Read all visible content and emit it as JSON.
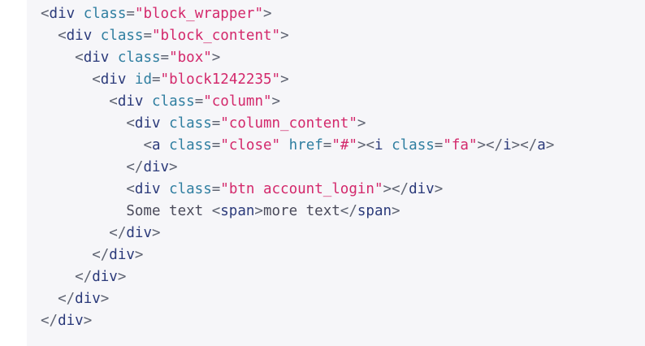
{
  "colors": {
    "background": "#f6f6f9",
    "punctuation": "#5f6472",
    "tag": "#2b3a7a",
    "attribute": "#2f7ea0",
    "value": "#d3286b",
    "text": "#4a4a5a"
  },
  "code_lines": [
    {
      "indent": 0,
      "tokens": [
        {
          "t": "punct",
          "v": "<"
        },
        {
          "t": "tag",
          "v": "div"
        },
        {
          "t": "text",
          "v": " "
        },
        {
          "t": "attr",
          "v": "class"
        },
        {
          "t": "punct",
          "v": "="
        },
        {
          "t": "value",
          "v": "\"block_wrapper\""
        },
        {
          "t": "punct",
          "v": ">"
        }
      ]
    },
    {
      "indent": 1,
      "tokens": [
        {
          "t": "punct",
          "v": "<"
        },
        {
          "t": "tag",
          "v": "div"
        },
        {
          "t": "text",
          "v": " "
        },
        {
          "t": "attr",
          "v": "class"
        },
        {
          "t": "punct",
          "v": "="
        },
        {
          "t": "value",
          "v": "\"block_content\""
        },
        {
          "t": "punct",
          "v": ">"
        }
      ]
    },
    {
      "indent": 2,
      "tokens": [
        {
          "t": "punct",
          "v": "<"
        },
        {
          "t": "tag",
          "v": "div"
        },
        {
          "t": "text",
          "v": " "
        },
        {
          "t": "attr",
          "v": "class"
        },
        {
          "t": "punct",
          "v": "="
        },
        {
          "t": "value",
          "v": "\"box\""
        },
        {
          "t": "punct",
          "v": ">"
        }
      ]
    },
    {
      "indent": 3,
      "tokens": [
        {
          "t": "punct",
          "v": "<"
        },
        {
          "t": "tag",
          "v": "div"
        },
        {
          "t": "text",
          "v": " "
        },
        {
          "t": "attr",
          "v": "id"
        },
        {
          "t": "punct",
          "v": "="
        },
        {
          "t": "value",
          "v": "\"block1242235\""
        },
        {
          "t": "punct",
          "v": ">"
        }
      ]
    },
    {
      "indent": 4,
      "tokens": [
        {
          "t": "punct",
          "v": "<"
        },
        {
          "t": "tag",
          "v": "div"
        },
        {
          "t": "text",
          "v": " "
        },
        {
          "t": "attr",
          "v": "class"
        },
        {
          "t": "punct",
          "v": "="
        },
        {
          "t": "value",
          "v": "\"column\""
        },
        {
          "t": "punct",
          "v": ">"
        }
      ]
    },
    {
      "indent": 5,
      "tokens": [
        {
          "t": "punct",
          "v": "<"
        },
        {
          "t": "tag",
          "v": "div"
        },
        {
          "t": "text",
          "v": " "
        },
        {
          "t": "attr",
          "v": "class"
        },
        {
          "t": "punct",
          "v": "="
        },
        {
          "t": "value",
          "v": "\"column_content\""
        },
        {
          "t": "punct",
          "v": ">"
        }
      ]
    },
    {
      "indent": 6,
      "tokens": [
        {
          "t": "punct",
          "v": "<"
        },
        {
          "t": "tag",
          "v": "a"
        },
        {
          "t": "text",
          "v": " "
        },
        {
          "t": "attr",
          "v": "class"
        },
        {
          "t": "punct",
          "v": "="
        },
        {
          "t": "value",
          "v": "\"close\""
        },
        {
          "t": "text",
          "v": " "
        },
        {
          "t": "attr",
          "v": "href"
        },
        {
          "t": "punct",
          "v": "="
        },
        {
          "t": "value",
          "v": "\"#\""
        },
        {
          "t": "punct",
          "v": "><"
        },
        {
          "t": "tag",
          "v": "i"
        },
        {
          "t": "text",
          "v": " "
        },
        {
          "t": "attr",
          "v": "class"
        },
        {
          "t": "punct",
          "v": "="
        },
        {
          "t": "value",
          "v": "\"fa\""
        },
        {
          "t": "punct",
          "v": "></"
        },
        {
          "t": "tag",
          "v": "i"
        },
        {
          "t": "punct",
          "v": "></"
        },
        {
          "t": "tag",
          "v": "a"
        },
        {
          "t": "punct",
          "v": ">"
        }
      ]
    },
    {
      "indent": 5,
      "tokens": [
        {
          "t": "punct",
          "v": "</"
        },
        {
          "t": "tag",
          "v": "div"
        },
        {
          "t": "punct",
          "v": ">"
        }
      ]
    },
    {
      "indent": 5,
      "tokens": [
        {
          "t": "punct",
          "v": "<"
        },
        {
          "t": "tag",
          "v": "div"
        },
        {
          "t": "text",
          "v": " "
        },
        {
          "t": "attr",
          "v": "class"
        },
        {
          "t": "punct",
          "v": "="
        },
        {
          "t": "value",
          "v": "\"btn account_login\""
        },
        {
          "t": "punct",
          "v": "></"
        },
        {
          "t": "tag",
          "v": "div"
        },
        {
          "t": "punct",
          "v": ">"
        }
      ]
    },
    {
      "indent": 5,
      "tokens": [
        {
          "t": "text",
          "v": "Some text "
        },
        {
          "t": "punct",
          "v": "<"
        },
        {
          "t": "tag",
          "v": "span"
        },
        {
          "t": "punct",
          "v": ">"
        },
        {
          "t": "text",
          "v": "more text"
        },
        {
          "t": "punct",
          "v": "</"
        },
        {
          "t": "tag",
          "v": "span"
        },
        {
          "t": "punct",
          "v": ">"
        }
      ]
    },
    {
      "indent": 4,
      "tokens": [
        {
          "t": "punct",
          "v": "</"
        },
        {
          "t": "tag",
          "v": "div"
        },
        {
          "t": "punct",
          "v": ">"
        }
      ]
    },
    {
      "indent": 3,
      "tokens": [
        {
          "t": "punct",
          "v": "</"
        },
        {
          "t": "tag",
          "v": "div"
        },
        {
          "t": "punct",
          "v": ">"
        }
      ]
    },
    {
      "indent": 2,
      "tokens": [
        {
          "t": "punct",
          "v": "</"
        },
        {
          "t": "tag",
          "v": "div"
        },
        {
          "t": "punct",
          "v": ">"
        }
      ]
    },
    {
      "indent": 1,
      "tokens": [
        {
          "t": "punct",
          "v": "</"
        },
        {
          "t": "tag",
          "v": "div"
        },
        {
          "t": "punct",
          "v": ">"
        }
      ]
    },
    {
      "indent": 0,
      "tokens": [
        {
          "t": "punct",
          "v": "</"
        },
        {
          "t": "tag",
          "v": "div"
        },
        {
          "t": "punct",
          "v": ">"
        }
      ]
    }
  ]
}
